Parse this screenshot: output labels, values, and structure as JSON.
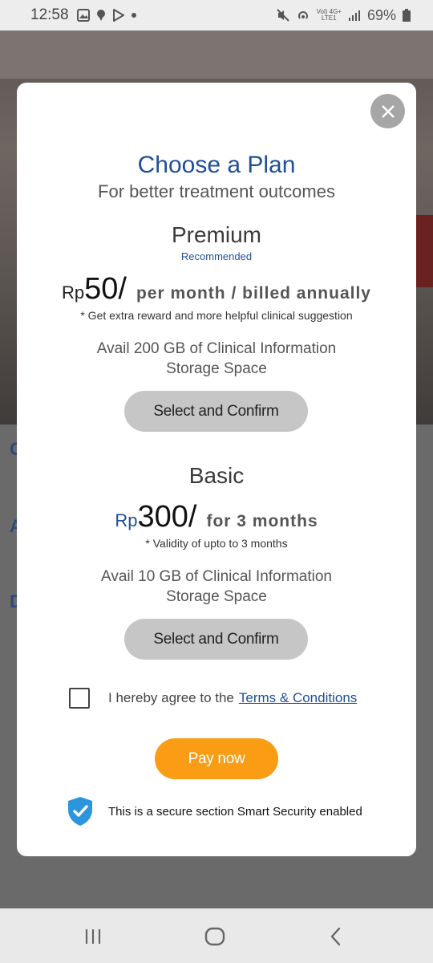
{
  "status_bar": {
    "time": "12:58",
    "network": "Vol) 4G+",
    "network_sub": "LTE1",
    "battery": "69%"
  },
  "background": {
    "letters": [
      "C",
      "A",
      "D"
    ]
  },
  "modal": {
    "title": "Choose a Plan",
    "subtitle": "For better treatment outcomes",
    "plans": [
      {
        "name": "Premium",
        "tag": "Recommended",
        "currency": "Rp",
        "amount": "50/",
        "period": "per month / billed annually",
        "note": "* Get extra reward and more helpful clinical suggestion",
        "feature_line1": "Avail 200 GB of Clinical Information",
        "feature_line2": "Storage Space",
        "button_label": "Select and Confirm"
      },
      {
        "name": "Basic",
        "currency": "Rp",
        "amount": "300/",
        "period": "for 3 months",
        "note": "* Validity of upto to 3 months",
        "feature_line1": "Avail 10 GB of Clinical Information",
        "feature_line2": "Storage Space",
        "button_label": "Select and Confirm"
      }
    ],
    "terms_text": "I hereby agree to the",
    "terms_link": "Terms & Conditions",
    "pay_button": "Pay now",
    "secure_text": "This is a secure section Smart Security enabled",
    "colors": {
      "title_blue": "#1f4f98",
      "pay_orange": "#fa9d14",
      "button_gray": "#c6c6c6",
      "shield_blue": "#2d95dc"
    }
  },
  "icons": {
    "close": "close-icon",
    "shield": "shield-check-icon",
    "nav": [
      "recent-apps-icon",
      "home-icon",
      "back-icon"
    ]
  }
}
